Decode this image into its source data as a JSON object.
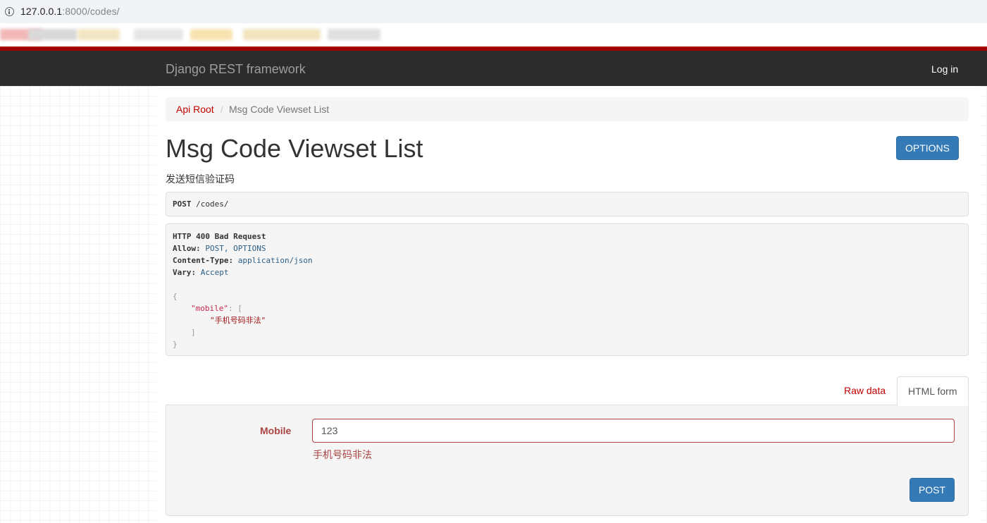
{
  "browser": {
    "url_host": "127.0.0.1",
    "url_rest": ":8000/codes/"
  },
  "navbar": {
    "brand": "Django REST framework",
    "login": "Log in"
  },
  "breadcrumb": {
    "root": "Api Root",
    "separator": "/",
    "current": "Msg Code Viewset List"
  },
  "page": {
    "title": "Msg Code Viewset List",
    "options_label": "OPTIONS",
    "description": "发送短信验证码"
  },
  "request": {
    "method": "POST",
    "path": "/codes/"
  },
  "response": {
    "status": "HTTP 400 Bad Request",
    "headers": [
      {
        "name": "Allow:",
        "value": "POST, OPTIONS"
      },
      {
        "name": "Content-Type:",
        "value": "application/json"
      },
      {
        "name": "Vary:",
        "value": "Accept"
      }
    ],
    "body": {
      "open_brace": "{",
      "key": "\"mobile\"",
      "colon_bracket": ": [",
      "message": "\"手机号码非法\"",
      "close_bracket": "]",
      "close_brace": "}"
    }
  },
  "tabs": {
    "raw": "Raw data",
    "html": "HTML form"
  },
  "form": {
    "mobile_label": "Mobile",
    "mobile_value": "123",
    "mobile_error": "手机号码非法",
    "submit_label": "POST"
  },
  "colors": {
    "nav_bg": "#2c2c2c",
    "accent_red": "#c20000",
    "error": "#a94442",
    "primary_button": "#337ab7"
  }
}
